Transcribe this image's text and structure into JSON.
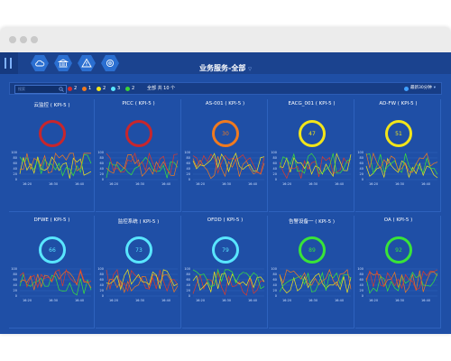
{
  "page": {
    "title": "业务服务-全部"
  },
  "toolbar": {
    "icons": [
      "cloud-icon",
      "bank-icon",
      "warning-icon",
      "gear-icon"
    ]
  },
  "filter": {
    "search_placeholder": "搜索",
    "statuses": [
      {
        "name": "critical",
        "count": "2",
        "color": "#d72b2b"
      },
      {
        "name": "major",
        "count": "1",
        "color": "#f07a1f"
      },
      {
        "name": "minor",
        "count": "2",
        "color": "#f2e51a"
      },
      {
        "name": "warning",
        "count": "3",
        "color": "#59e6ff"
      },
      {
        "name": "normal",
        "count": "2",
        "color": "#39d338"
      }
    ],
    "summary": "全部 共 10 个",
    "refresh": "最新30分钟"
  },
  "cards": [
    {
      "name": "云监控 ( KPI-5 )",
      "value": "",
      "color": "#c8262c"
    },
    {
      "name": "PICC ( KPI-5 )",
      "value": "",
      "color": "#c8262c"
    },
    {
      "name": "AS-001 ( KPI-5 )",
      "value": "30",
      "color": "#f07a1f"
    },
    {
      "name": "EACG_001 ( KPI-5 )",
      "value": "47",
      "color": "#f2e51a"
    },
    {
      "name": "AD-FW ( KPI-5 )",
      "value": "51",
      "color": "#f2e51a"
    },
    {
      "name": "DFWE ( KPI-5 )",
      "value": "66",
      "color": "#59e6ff"
    },
    {
      "name": "监控系统 ( KPI-5 )",
      "value": "73",
      "color": "#59e6ff"
    },
    {
      "name": "OFDD ( KPI-5 )",
      "value": "79",
      "color": "#59e6ff"
    },
    {
      "name": "告警设备一 ( KPI-5 )",
      "value": "89",
      "color": "#39e438"
    },
    {
      "name": "OA ( KPI-5 )",
      "value": "92",
      "color": "#39e438"
    }
  ],
  "chart_data": {
    "type": "line",
    "x": [
      "16:20",
      "16:30",
      "16:40"
    ],
    "ylim": [
      0,
      100
    ],
    "yticks": [
      0,
      20,
      40,
      60,
      80,
      100
    ]
  }
}
